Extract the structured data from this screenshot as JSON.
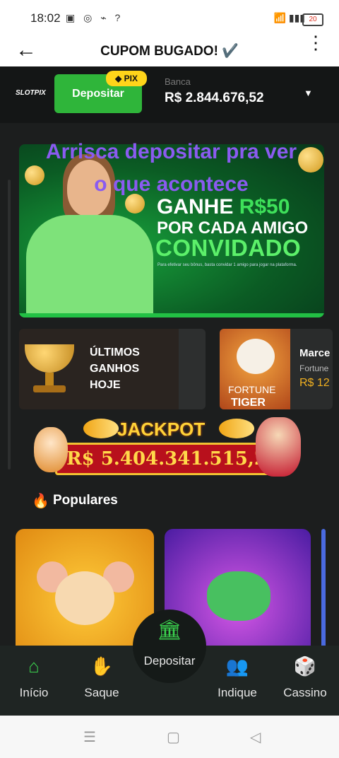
{
  "status_bar": {
    "time": "18:02",
    "left_icons": "▣ ◎ ⌁ ?",
    "right_icons": "📶 ▮▮▮",
    "battery": "20"
  },
  "app_bar": {
    "title": "CUPOM BUGADO! ✔️",
    "back_icon": "arrow-left",
    "more_icon": "kebab-menu"
  },
  "header": {
    "logo": "SLOTPIX",
    "deposit_button": "Depositar",
    "pix_badge": "◆ PIX",
    "banca_label": "Banca",
    "banca_value": "R$  2.844.676,52",
    "dropdown_icon": "caret-down"
  },
  "banner": {
    "line1_prefix": "GANHE ",
    "line1_highlight": "R$50",
    "line2": "POR CADA AMIGO",
    "line3": "CONVIDADO",
    "fine_print": "Para efetivar seu bônus, basta convidar 1 amigo para jogar na plataforma."
  },
  "overlay_caption": "Arrisca depositar pra ver o que acontece",
  "wins_card": {
    "title": "ÚLTIMOS\nGANHOS\nHOJE"
  },
  "recent_win": {
    "thumb_line1": "FORTUNE",
    "thumb_line2": "TIGER",
    "player": "Marce",
    "game": "Fortune",
    "amount": "R$ 12"
  },
  "jackpot": {
    "title": "JACKPOT",
    "value": "R$ 5.404.341.515,27"
  },
  "popular": {
    "icon": "🔥",
    "label": "Populares"
  },
  "bottom_nav": {
    "items": [
      {
        "label": "Início",
        "icon": "⌂"
      },
      {
        "label": "Saque",
        "icon": "✋"
      },
      {
        "label": "Indique",
        "icon": "👥"
      },
      {
        "label": "Cassino",
        "icon": "🎲"
      }
    ],
    "center": {
      "label": "Depositar",
      "icon": "🏛"
    }
  },
  "system_nav": {
    "recent": "☰",
    "home": "▢",
    "back": "◁"
  },
  "colors": {
    "accent_green": "#2fb53a",
    "jackpot_red": "#b8101c",
    "caption_purple": "#8a5bf0",
    "gold": "#ffd338"
  }
}
